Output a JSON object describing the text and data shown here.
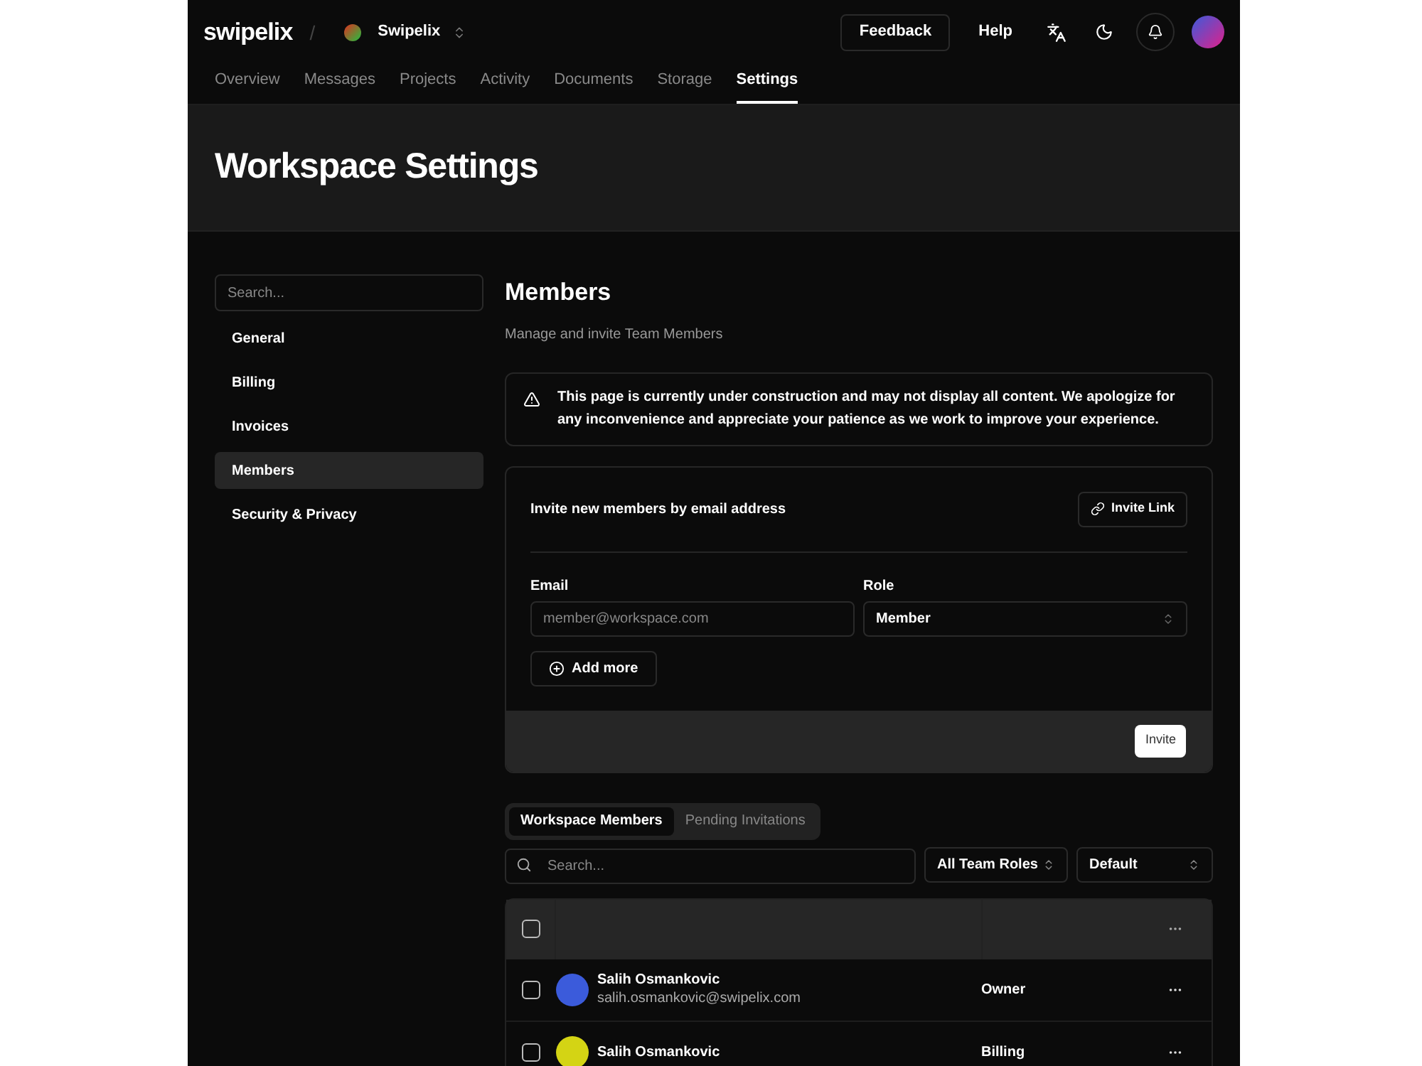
{
  "header": {
    "logo": "swipelix",
    "separator": "/",
    "workspace": "Swipelix",
    "feedback": "Feedback",
    "help": "Help"
  },
  "nav": [
    {
      "label": "Overview",
      "selected": false
    },
    {
      "label": "Messages",
      "selected": false
    },
    {
      "label": "Projects",
      "selected": false
    },
    {
      "label": "Activity",
      "selected": false
    },
    {
      "label": "Documents",
      "selected": false
    },
    {
      "label": "Storage",
      "selected": false
    },
    {
      "label": "Settings",
      "selected": true
    }
  ],
  "page_title": "Workspace Settings",
  "sidebar": {
    "search_placeholder": "Search...",
    "items": [
      {
        "label": "General",
        "selected": false
      },
      {
        "label": "Billing",
        "selected": false
      },
      {
        "label": "Invoices",
        "selected": false
      },
      {
        "label": "Members",
        "selected": true
      },
      {
        "label": "Security & Privacy",
        "selected": false
      }
    ]
  },
  "section": {
    "title": "Members",
    "subtitle": "Manage and invite Team Members",
    "notice": "This page is currently under construction and may not display all content. We apologize for any inconvenience and appreciate your patience as we work to improve your experience."
  },
  "invite": {
    "heading": "Invite new members by email address",
    "link_button": "Invite Link",
    "email_label": "Email",
    "email_placeholder": "member@workspace.com",
    "role_label": "Role",
    "role_value": "Member",
    "add_more": "Add more",
    "submit": "Invite"
  },
  "member_tabs": [
    {
      "label": "Workspace Members",
      "selected": true
    },
    {
      "label": "Pending Invitations",
      "selected": false
    }
  ],
  "filters": {
    "search_placeholder": "Search...",
    "roles": "All Team Roles",
    "sort": "Default"
  },
  "table": {
    "header_checked": false,
    "rows": [
      {
        "name": "Salih Osmankovic",
        "email": "salih.osmankovic@swipelix.com",
        "role": "Owner",
        "checked": false,
        "color": "#3b5bdb"
      },
      {
        "name": "Salih Osmankovic",
        "role": "Billing",
        "checked": false,
        "color": "#d4d414"
      }
    ]
  }
}
